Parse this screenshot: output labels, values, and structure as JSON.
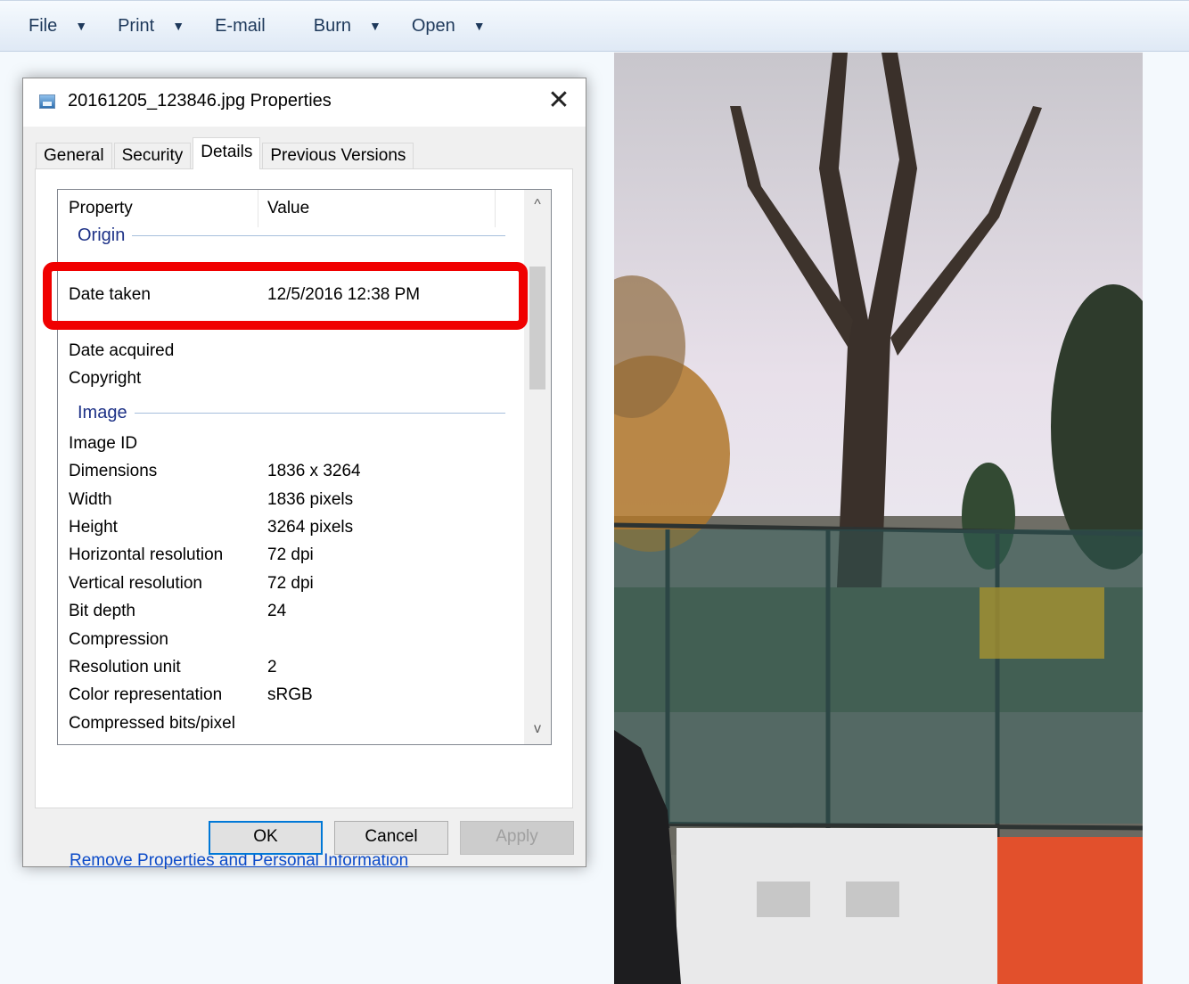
{
  "toolbar": {
    "items": [
      {
        "label": "File",
        "has_menu": true
      },
      {
        "label": "Print",
        "has_menu": true
      },
      {
        "label": "E-mail",
        "has_menu": false
      },
      {
        "label": "Burn",
        "has_menu": true
      },
      {
        "label": "Open",
        "has_menu": true
      }
    ],
    "caret": "▼"
  },
  "dialog": {
    "title": "20161205_123846.jpg Properties",
    "close_glyph": "✕",
    "tabs": [
      "General",
      "Security",
      "Details",
      "Previous Versions"
    ],
    "active_tab": "Details",
    "list": {
      "header": {
        "property": "Property",
        "value": "Value"
      },
      "groups": {
        "origin": "Origin",
        "image": "Image"
      },
      "rows": [
        {
          "key": "Date taken",
          "value": "12/5/2016 12:38 PM"
        },
        {
          "key": "Date acquired",
          "value": ""
        },
        {
          "key": "Copyright",
          "value": ""
        },
        {
          "key": "Image ID",
          "value": ""
        },
        {
          "key": "Dimensions",
          "value": "1836 x 3264"
        },
        {
          "key": "Width",
          "value": "1836 pixels"
        },
        {
          "key": "Height",
          "value": "3264 pixels"
        },
        {
          "key": "Horizontal resolution",
          "value": "72 dpi"
        },
        {
          "key": "Vertical resolution",
          "value": "72 dpi"
        },
        {
          "key": "Bit depth",
          "value": "24"
        },
        {
          "key": "Compression",
          "value": ""
        },
        {
          "key": "Resolution unit",
          "value": "2"
        },
        {
          "key": "Color representation",
          "value": "sRGB"
        },
        {
          "key": "Compressed bits/pixel",
          "value": ""
        }
      ],
      "scroll_up": "^",
      "scroll_down": "v"
    },
    "link": "Remove Properties and Personal Information",
    "buttons": {
      "ok": "OK",
      "cancel": "Cancel",
      "apply": "Apply"
    }
  },
  "highlight_color": "#f00000",
  "accent_color": "#0078d7",
  "link_color": "#0b4ac8"
}
